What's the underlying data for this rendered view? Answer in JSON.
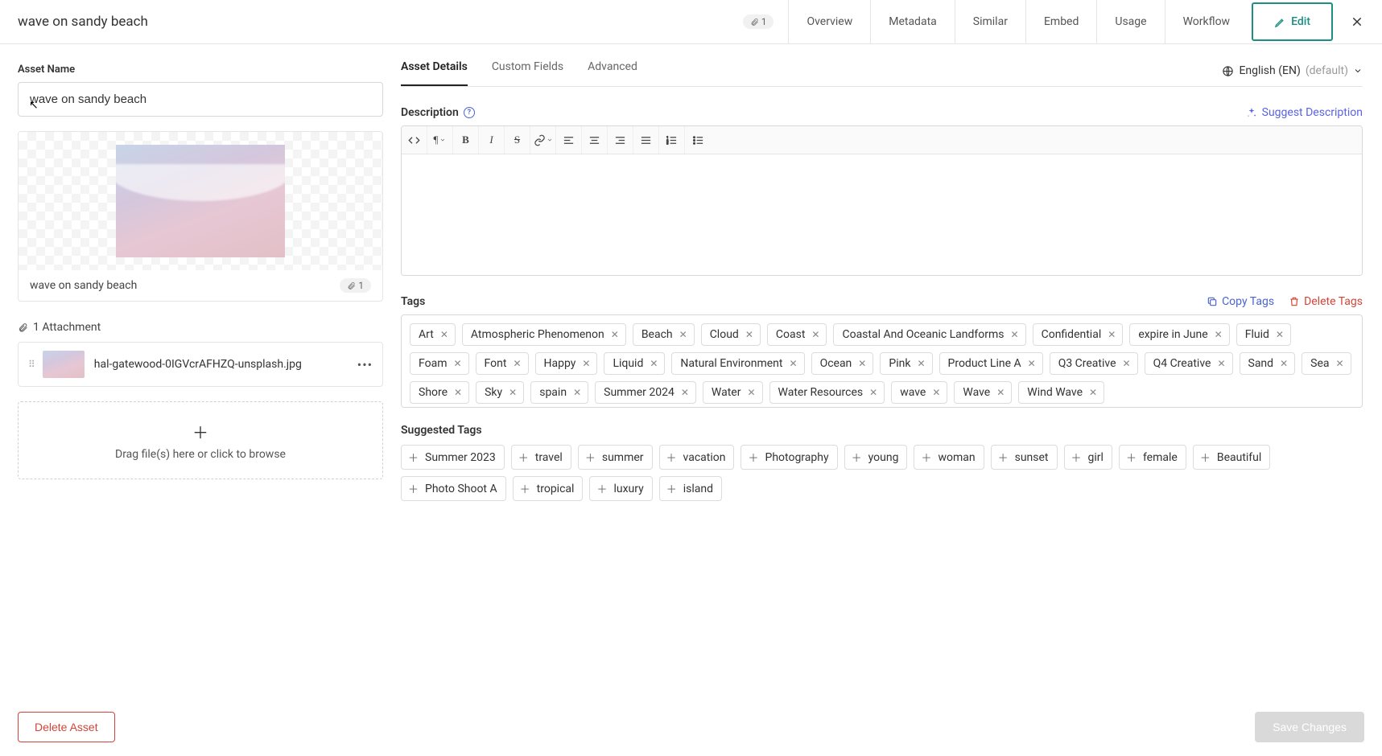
{
  "header": {
    "title": "wave on sandy beach",
    "badge_count": "1",
    "nav": [
      "Overview",
      "Metadata",
      "Similar",
      "Embed",
      "Usage",
      "Workflow"
    ],
    "edit_label": "Edit"
  },
  "left": {
    "asset_name_label": "Asset Name",
    "asset_name_value": "wave on sandy beach",
    "preview_caption": "wave on sandy beach",
    "preview_badge": "1",
    "attachments_label": "1 Attachment",
    "attachment_filename": "hal-gatewood-0IGVcrAFHZQ-unsplash.jpg",
    "dropzone_text": "Drag file(s) here or click to browse"
  },
  "subtabs": {
    "items": [
      "Asset Details",
      "Custom Fields",
      "Advanced"
    ],
    "language_main": "English (EN)",
    "language_suffix": "(default)"
  },
  "description": {
    "label": "Description",
    "suggest_label": "Suggest Description"
  },
  "tags": {
    "label": "Tags",
    "copy_label": "Copy Tags",
    "delete_label": "Delete Tags",
    "items": [
      "Art",
      "Atmospheric Phenomenon",
      "Beach",
      "Cloud",
      "Coast",
      "Coastal And Oceanic Landforms",
      "Confidential",
      "expire in June",
      "Fluid",
      "Foam",
      "Font",
      "Happy",
      "Liquid",
      "Natural Environment",
      "Ocean",
      "Pink",
      "Product Line A",
      "Q3 Creative",
      "Q4 Creative",
      "Sand",
      "Sea",
      "Shore",
      "Sky",
      "spain",
      "Summer 2024",
      "Water",
      "Water Resources",
      "wave",
      "Wave",
      "Wind Wave"
    ]
  },
  "suggested_tags": {
    "label": "Suggested Tags",
    "items": [
      "Summer 2023",
      "travel",
      "summer",
      "vacation",
      "Photography",
      "young",
      "woman",
      "sunset",
      "girl",
      "female",
      "Beautiful",
      "Photo Shoot A",
      "tropical",
      "luxury",
      "island"
    ]
  },
  "footer": {
    "delete_label": "Delete Asset",
    "save_label": "Save Changes"
  }
}
